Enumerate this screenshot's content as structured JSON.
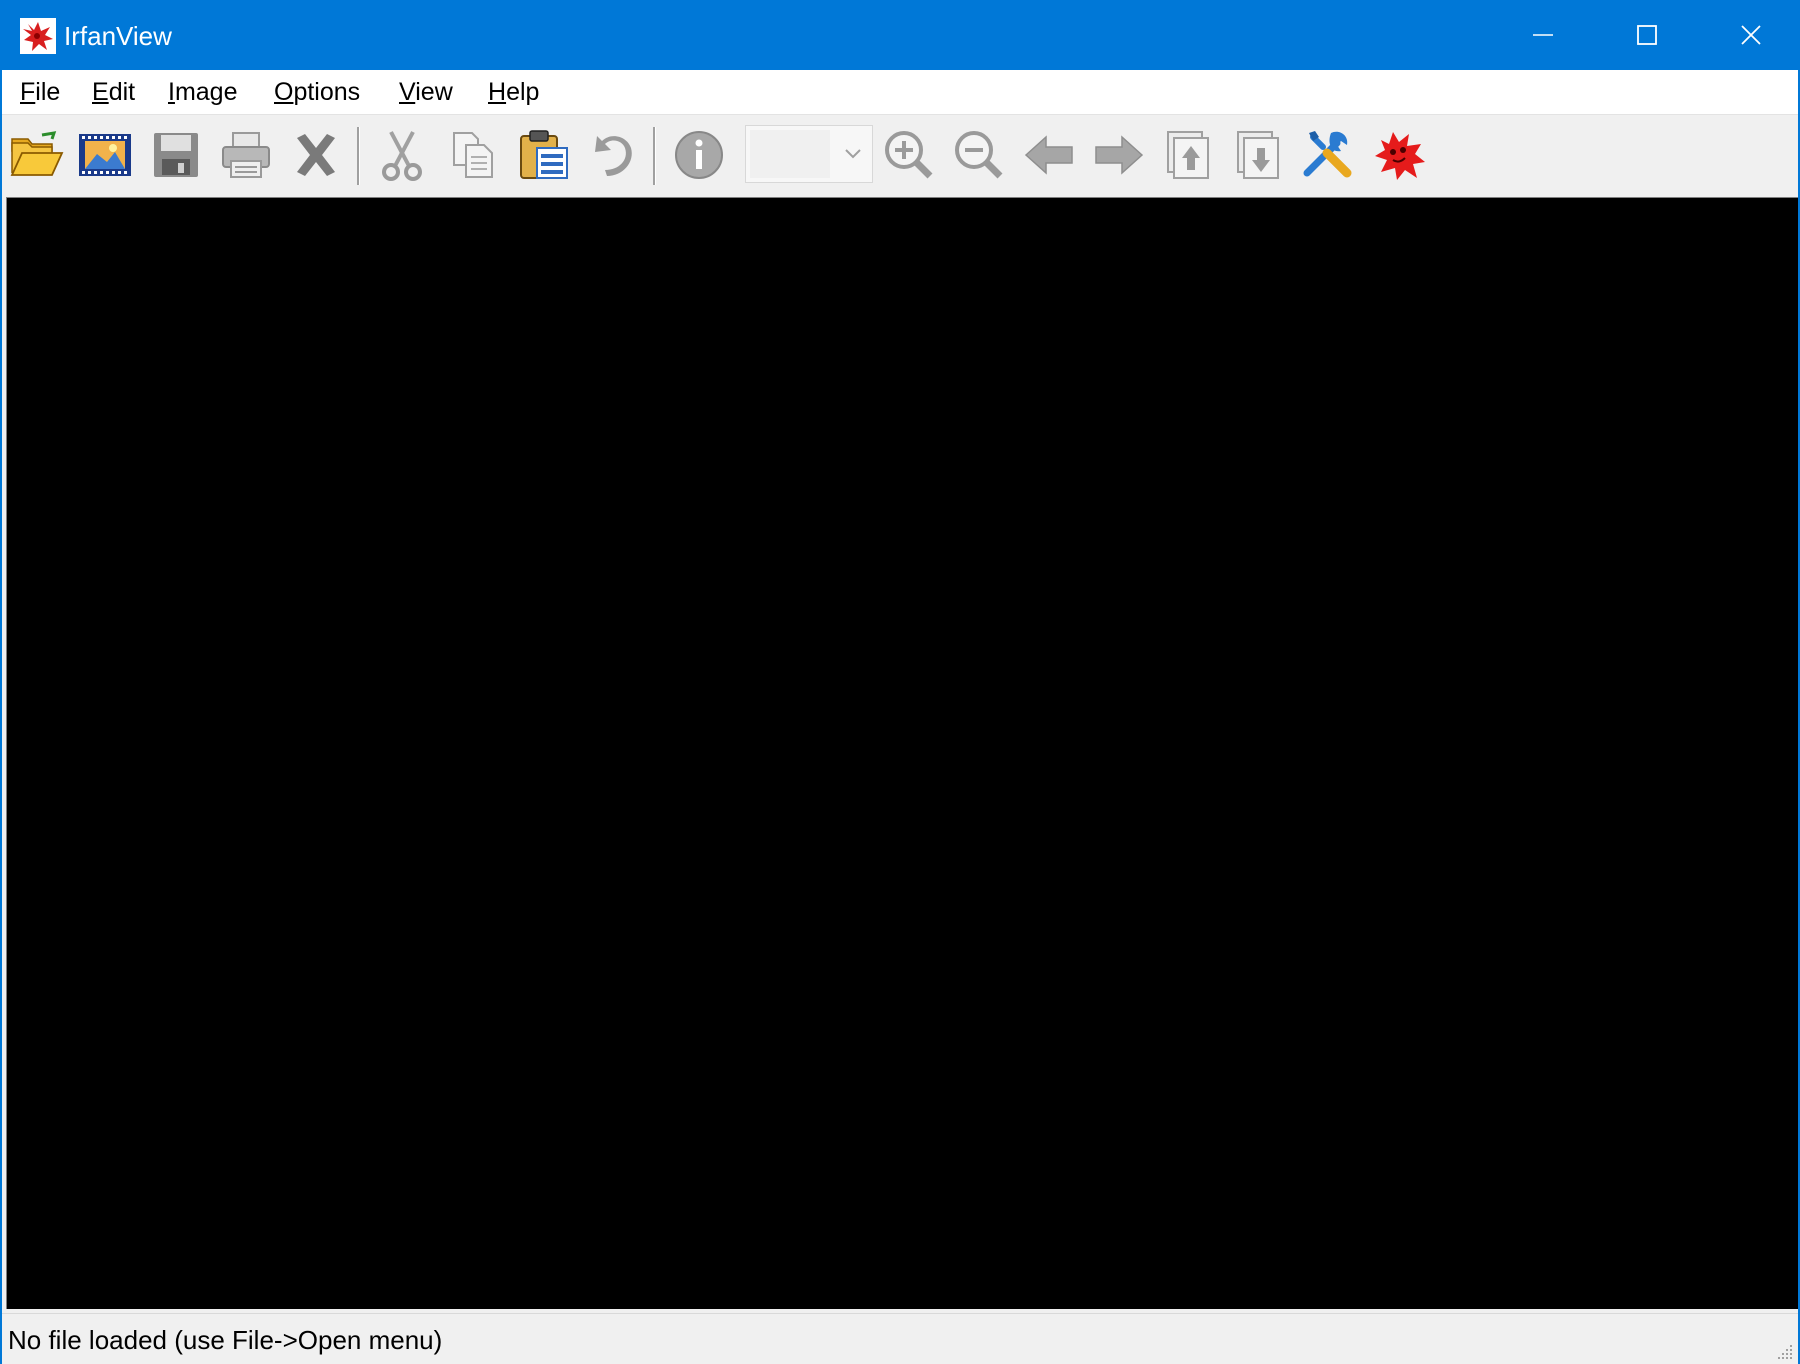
{
  "window": {
    "title": "IrfanView",
    "accent_color": "#0078d7",
    "controls": {
      "minimize_icon": "minimize-icon",
      "maximize_icon": "maximize-icon",
      "close_icon": "close-icon"
    }
  },
  "menubar": {
    "items": [
      {
        "label": "File",
        "mnemonic": "F",
        "rest": "ile"
      },
      {
        "label": "Edit",
        "mnemonic": "E",
        "rest": "dit"
      },
      {
        "label": "Image",
        "mnemonic": "I",
        "rest": "mage"
      },
      {
        "label": "Options",
        "mnemonic": "O",
        "rest": "ptions"
      },
      {
        "label": "View",
        "mnemonic": "V",
        "rest": "iew"
      },
      {
        "label": "Help",
        "mnemonic": "H",
        "rest": "elp"
      }
    ]
  },
  "toolbar": {
    "buttons": [
      {
        "name": "open",
        "icon": "folder-open-icon",
        "enabled": true
      },
      {
        "name": "slideshow",
        "icon": "filmstrip-icon",
        "enabled": true
      },
      {
        "name": "save",
        "icon": "floppy-disk-icon",
        "enabled": false
      },
      {
        "name": "print",
        "icon": "printer-icon",
        "enabled": false
      },
      {
        "name": "delete",
        "icon": "delete-x-icon",
        "enabled": false
      },
      {
        "name": "cut",
        "icon": "scissors-icon",
        "enabled": false
      },
      {
        "name": "copy",
        "icon": "copy-icon",
        "enabled": false
      },
      {
        "name": "paste",
        "icon": "clipboard-paste-icon",
        "enabled": true
      },
      {
        "name": "undo",
        "icon": "undo-arrow-icon",
        "enabled": false
      },
      {
        "name": "info",
        "icon": "info-circle-icon",
        "enabled": false
      },
      {
        "name": "zoom-in",
        "icon": "zoom-in-icon",
        "enabled": false
      },
      {
        "name": "zoom-out",
        "icon": "zoom-out-icon",
        "enabled": false
      },
      {
        "name": "previous",
        "icon": "arrow-left-icon",
        "enabled": false
      },
      {
        "name": "next",
        "icon": "arrow-right-icon",
        "enabled": false
      },
      {
        "name": "first-file",
        "icon": "page-up-icon",
        "enabled": false
      },
      {
        "name": "last-file",
        "icon": "page-down-icon",
        "enabled": false
      },
      {
        "name": "properties",
        "icon": "tools-icon",
        "enabled": true
      },
      {
        "name": "about",
        "icon": "irfanview-logo-icon",
        "enabled": true
      }
    ],
    "zoom_combo": {
      "value": "",
      "arrow_icon": "chevron-down-icon"
    }
  },
  "canvas": {
    "background": "#000000"
  },
  "statusbar": {
    "text": "No file loaded (use File->Open menu)"
  }
}
